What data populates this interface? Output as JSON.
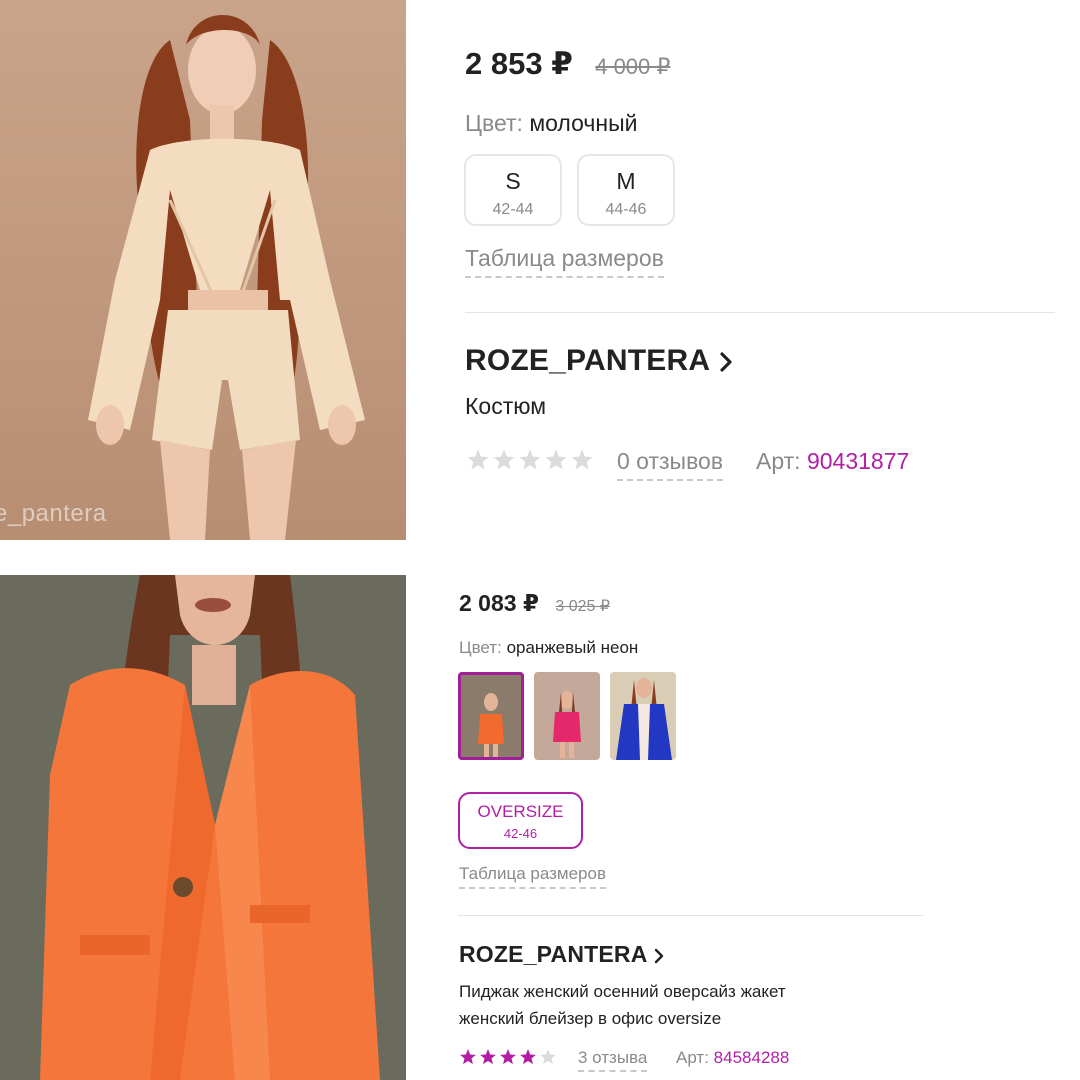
{
  "colors": {
    "accent": "#b21fa6",
    "text": "#222222",
    "muted": "#8a8a8a",
    "divider": "#e4e4e4",
    "star_empty": "#dcdcdc",
    "star_filled": "#b21fa6"
  },
  "product1": {
    "image": {
      "alt": "product-photo-cream-suit",
      "watermark": "e_pantera"
    },
    "price": "2 853 ₽",
    "old_price": "4 000 ₽",
    "color_label": "Цвет:",
    "color_value": "молочный",
    "sizes": [
      {
        "size": "S",
        "range": "42-44"
      },
      {
        "size": "M",
        "range": "44-46"
      }
    ],
    "size_table": "Таблица размеров",
    "brand": "ROZE_PANTERA",
    "title": "Костюм",
    "rating": 0,
    "reviews": "0 отзывов",
    "article_label": "Арт:",
    "article": "90431877"
  },
  "product2": {
    "image": {
      "alt": "product-photo-orange-blazer"
    },
    "price": "2 083 ₽",
    "old_price": "3 025 ₽",
    "color_label": "Цвет:",
    "color_value": "оранжевый неон",
    "color_thumbs": [
      {
        "name": "orange",
        "color": "#f26a2e",
        "selected": true
      },
      {
        "name": "pink",
        "color": "#e5286a",
        "selected": false
      },
      {
        "name": "blue",
        "color": "#2238c2",
        "selected": false
      }
    ],
    "sizes": [
      {
        "size": "OVERSIZE",
        "range": "42-46",
        "selected": true
      }
    ],
    "size_table": "Таблица размеров",
    "brand": "ROZE_PANTERA",
    "title_line1": "Пиджак женский осенний оверсайз жакет",
    "title_line2": "женский блейзер в офис oversize",
    "rating": 4,
    "reviews": "3 отзыва",
    "article_label": "Арт:",
    "article": "84584288"
  }
}
